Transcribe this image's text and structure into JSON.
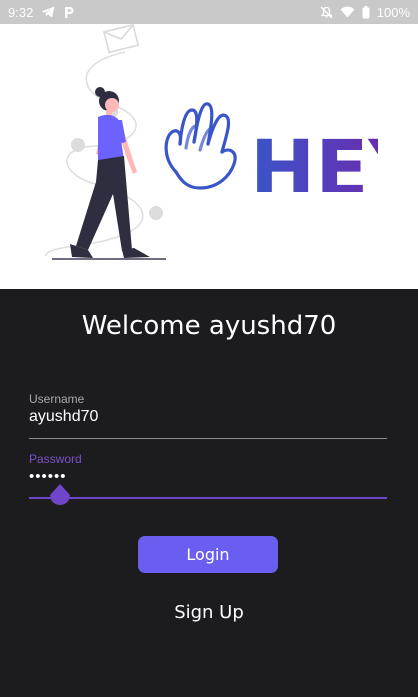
{
  "status_bar": {
    "time": "9:32",
    "battery": "100%",
    "left_icons": [
      "telegram-icon",
      "parking-icon"
    ],
    "right_icons": [
      "mute-icon",
      "wifi-icon",
      "battery-icon"
    ]
  },
  "hero": {
    "logo_text": "HEY",
    "illustration": "woman-walking-illustration"
  },
  "login": {
    "welcome": "Welcome ayushd70",
    "username_label": "Username",
    "username_value": "ayushd70",
    "password_label": "Password",
    "password_value": "••••••",
    "login_label": "Login",
    "signup_label": "Sign Up"
  },
  "colors": {
    "accent": "#6a5ef0",
    "focus": "#6f46c9",
    "background": "#1c1b1e",
    "logo_start": "#3a55c9",
    "logo_end": "#7a1fa6"
  }
}
